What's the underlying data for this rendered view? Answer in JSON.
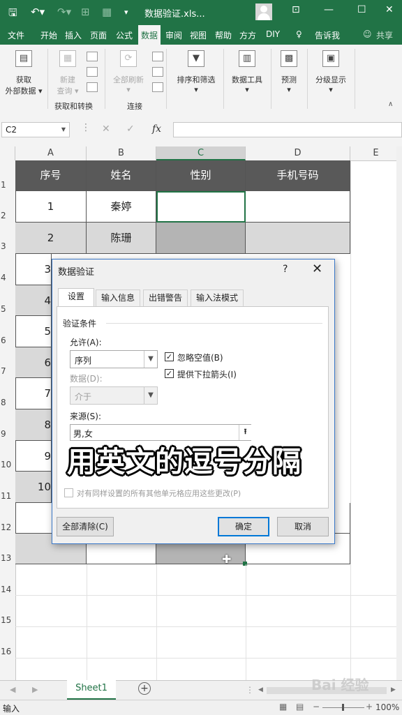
{
  "titlebar": {
    "doc_title": "数据验证.xls...",
    "qa_icons": [
      "save-icon",
      "undo-icon",
      "redo-icon",
      "border-icon",
      "table-icon",
      "more-icon"
    ],
    "win_icons": [
      "ribbon-display-icon",
      "minimize-icon",
      "restore-icon",
      "close-icon"
    ]
  },
  "tabs": {
    "file": "文件",
    "home": "开始",
    "insert": "插入",
    "page_layout": "页面",
    "formulas": "公式",
    "data": "数据",
    "review": "审阅",
    "view": "视图",
    "help": "帮助",
    "fangfang": "方方",
    "diy": "DIY",
    "tell_me": "告诉我",
    "share": "共享"
  },
  "ribbon": {
    "get_external_data_1": "获取",
    "get_external_data_2": "外部数据",
    "new_query_1": "新建",
    "new_query_2": "查询",
    "group_get_transform": "获取和转换",
    "refresh_all": "全部刷新",
    "group_connections": "连接",
    "sort_filter": "排序和筛选",
    "data_tools": "数据工具",
    "forecast": "预测",
    "outline": "分级显示"
  },
  "formula_bar": {
    "name_box": "C2",
    "fx": "fx",
    "cancel": "✕",
    "enter": "✓"
  },
  "grid": {
    "columns": [
      "A",
      "B",
      "C",
      "D",
      "E"
    ],
    "rows": [
      "1",
      "2",
      "3",
      "4",
      "5",
      "6",
      "7",
      "8",
      "9",
      "10",
      "11",
      "12",
      "13",
      "14",
      "15",
      "16"
    ],
    "headers": [
      "序号",
      "姓名",
      "性别",
      "手机号码"
    ],
    "row2": [
      "1",
      "秦婷"
    ],
    "row3": [
      "2",
      "陈珊"
    ],
    "partial_a": [
      "3",
      "4",
      "5",
      "6",
      "7",
      "8",
      "9",
      "10"
    ]
  },
  "sheet": {
    "name": "Sheet1",
    "add": "+"
  },
  "status": {
    "mode": "输入",
    "zoom": "100%"
  },
  "dialog": {
    "title": "数据验证",
    "help": "?",
    "close": "✕",
    "tabs": [
      "设置",
      "输入信息",
      "出错警告",
      "输入法模式"
    ],
    "section": "验证条件",
    "allow_label": "允许(A):",
    "allow_value": "序列",
    "data_label": "数据(D):",
    "data_value": "介于",
    "ignore_blank": "忽略空值(B)",
    "dropdown": "提供下拉箭头(I)",
    "source_label": "来源(S):",
    "source_value": "男,女",
    "apply_all": "对有同样设置的所有其他单元格应用这些更改(P)",
    "clear_all": "全部清除(C)",
    "ok": "确定",
    "cancel": "取消"
  },
  "caption": "用英文的逗号分隔",
  "watermark": "Bai 经验"
}
